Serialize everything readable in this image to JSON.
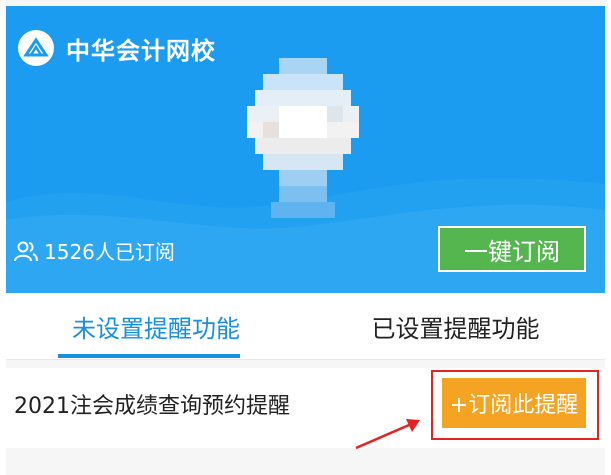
{
  "header": {
    "brand_name": "中华会计网校",
    "subscriber_text": "1526人已订阅",
    "subscribe_button": "一键订阅"
  },
  "tabs": [
    {
      "label": "未设置提醒功能",
      "active": true
    },
    {
      "label": "已设置提醒功能",
      "active": false
    }
  ],
  "reminders": [
    {
      "title": "2021注会成绩查询预约提醒",
      "button_label": "+订阅此提醒"
    }
  ],
  "colors": {
    "hero_blue": "#1c9cf0",
    "active_tab": "#1890e0",
    "subscribe_green": "#55b64f",
    "remind_orange": "#f5a323",
    "annotation_red": "#e52222"
  },
  "icons": [
    "brand-logo-icon",
    "people-icon",
    "arrow-icon"
  ]
}
